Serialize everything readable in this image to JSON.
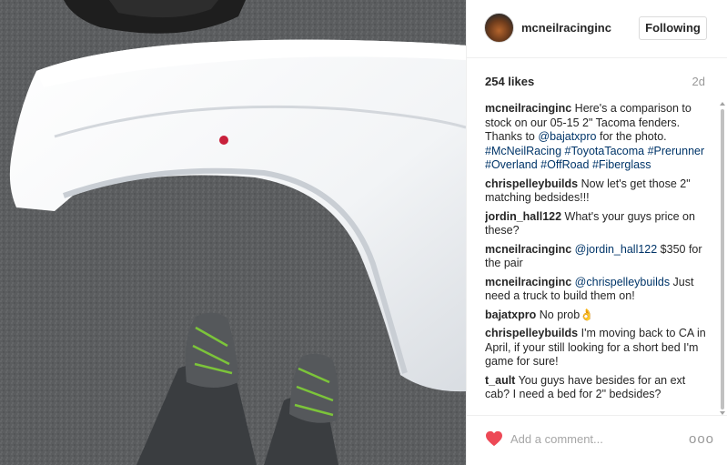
{
  "post": {
    "username": "mcneilracinginc",
    "follow_label": "Following",
    "likes": "254 likes",
    "age": "2d"
  },
  "comments": [
    {
      "user": "mcneilracinginc",
      "parts": [
        {
          "t": " Here's a comparison to stock on our 05-15 2\" Tacoma fenders. Thanks to "
        },
        {
          "t": "@bajatxpro",
          "link": true
        },
        {
          "t": " for the photo. "
        },
        {
          "t": "#McNeilRacing",
          "link": true
        },
        {
          "t": " "
        },
        {
          "t": "#ToyotaTacoma",
          "link": true
        },
        {
          "t": " "
        },
        {
          "t": "#Prerunner",
          "link": true
        },
        {
          "t": " "
        },
        {
          "t": "#Overland",
          "link": true
        },
        {
          "t": " "
        },
        {
          "t": "#OffRoad",
          "link": true
        },
        {
          "t": " "
        },
        {
          "t": "#Fiberglass",
          "link": true
        }
      ]
    },
    {
      "user": "chrispelleybuilds",
      "parts": [
        {
          "t": " Now let's get those 2\" matching bedsides!!!"
        }
      ]
    },
    {
      "user": "jordin_hall122",
      "parts": [
        {
          "t": " What's your guys price on these?"
        }
      ]
    },
    {
      "user": "mcneilracinginc",
      "parts": [
        {
          "t": " "
        },
        {
          "t": "@jordin_hall122",
          "link": true
        },
        {
          "t": " $350 for the pair"
        }
      ]
    },
    {
      "user": "mcneilracinginc",
      "parts": [
        {
          "t": " "
        },
        {
          "t": "@chrispelleybuilds",
          "link": true
        },
        {
          "t": " Just need a truck to build them on!"
        }
      ]
    },
    {
      "user": "bajatxpro",
      "parts": [
        {
          "t": " No prob👌"
        }
      ]
    },
    {
      "user": "chrispelleybuilds",
      "parts": [
        {
          "t": " I'm moving back to CA in April, if your still looking for a short bed I'm game for sure!"
        }
      ]
    },
    {
      "user": "t_ault",
      "parts": [
        {
          "t": " You guys have besides for an ext cab? I need a bed for 2\" bedsides?"
        }
      ]
    }
  ],
  "footer": {
    "comment_placeholder": "Add a comment...",
    "more_label": "ooo"
  },
  "colors": {
    "heart": "#ed4956",
    "link": "#003569"
  }
}
